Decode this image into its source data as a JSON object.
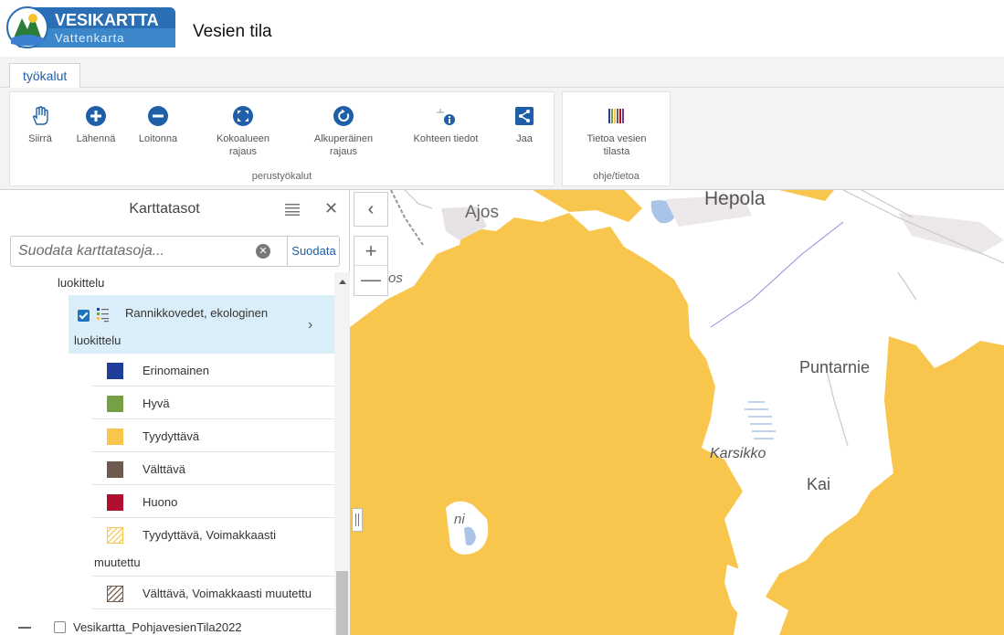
{
  "header": {
    "logo_title": "VESIKARTTA",
    "logo_subtitle": "Vattenkarta",
    "app_title": "Vesien tila"
  },
  "ribbon": {
    "tab_label": "työkalut",
    "groups": [
      {
        "caption": "perustyökalut",
        "tools": [
          {
            "label": "Siirrä",
            "icon": "hand-icon"
          },
          {
            "label": "Lähennä",
            "icon": "zoom-in-icon"
          },
          {
            "label": "Loitonna",
            "icon": "zoom-out-icon"
          },
          {
            "label": "Kokoalueen rajaus",
            "icon": "full-extent-icon"
          },
          {
            "label": "Alkuperäinen rajaus",
            "icon": "initial-extent-icon"
          },
          {
            "label": "Kohteen tiedot",
            "icon": "identify-icon"
          },
          {
            "label": "Jaa",
            "icon": "share-icon"
          }
        ]
      },
      {
        "caption": "ohje/tietoa",
        "tools": [
          {
            "label": "Tietoa vesien tilasta",
            "icon": "info-barcode-icon"
          }
        ]
      }
    ]
  },
  "layers_panel": {
    "title": "Karttatasot",
    "filter_placeholder": "Suodata karttatasoja...",
    "filter_button": "Suodata",
    "prev_item_tail": "luokittelu",
    "selected_layer": {
      "label_line1": "Rannikkovedet, ekologinen",
      "label_line2": "luokittelu",
      "checked": true
    },
    "legend": [
      {
        "label": "Erinomainen",
        "color": "#1f3d99"
      },
      {
        "label": "Hyvä",
        "color": "#76a046"
      },
      {
        "label": "Tyydyttävä",
        "color": "#f9c64d"
      },
      {
        "label": "Välttävä",
        "color": "#6e5a4f"
      },
      {
        "label": "Huono",
        "color": "#b0102f"
      },
      {
        "label": "Tyydyttävä, Voimakkaasti",
        "label2": "muutettu",
        "color": "#f9c64d",
        "hatched": true
      },
      {
        "label": "Välttävä, Voimakkaasti muutettu",
        "color": "#6e5a4f",
        "hatched": true
      }
    ],
    "next_item": "Vesikartta_PohjavesienTila2022"
  },
  "map": {
    "places": [
      "Hepola",
      "Ajos",
      "Puntarnie",
      "Karsikko",
      "Kai",
      "ni",
      "os"
    ],
    "sea_color": "#f9c64d",
    "land_color": "#ffffff",
    "water_color": "#a9c4e8"
  }
}
